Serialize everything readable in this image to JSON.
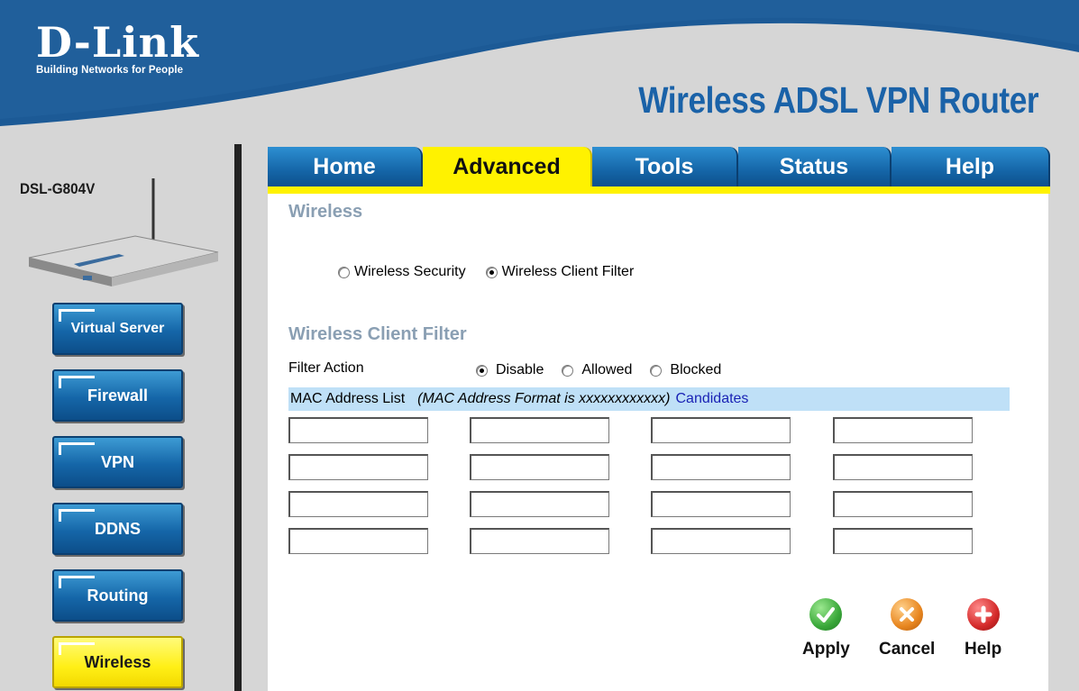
{
  "header": {
    "logo_main": "D-Link",
    "logo_tagline": "Building Networks for People",
    "product_title": "Wireless ADSL VPN Router"
  },
  "sidebar": {
    "model": "DSL-G804V",
    "items": [
      {
        "label": "Virtual Server",
        "active": false
      },
      {
        "label": "Firewall",
        "active": false
      },
      {
        "label": "VPN",
        "active": false
      },
      {
        "label": "DDNS",
        "active": false
      },
      {
        "label": "Routing",
        "active": false
      },
      {
        "label": "Wireless",
        "active": true
      }
    ]
  },
  "tabs": [
    {
      "label": "Home",
      "active": false
    },
    {
      "label": "Advanced",
      "active": true
    },
    {
      "label": "Tools",
      "active": false
    },
    {
      "label": "Status",
      "active": false
    },
    {
      "label": "Help",
      "active": false
    }
  ],
  "main": {
    "section_title": "Wireless",
    "mode_options": [
      {
        "label": "Wireless Security",
        "selected": false
      },
      {
        "label": "Wireless Client Filter",
        "selected": true
      }
    ],
    "filter_title": "Wireless Client Filter",
    "filter_action_label": "Filter Action",
    "filter_actions": [
      {
        "label": "Disable",
        "selected": true
      },
      {
        "label": "Allowed",
        "selected": false
      },
      {
        "label": "Blocked",
        "selected": false
      }
    ],
    "mac_list_label": "MAC Address List",
    "mac_format_hint": "(MAC Address Format is xxxxxxxxxxxx)",
    "candidates_link": "Candidates",
    "mac_fields": [
      "",
      "",
      "",
      "",
      "",
      "",
      "",
      "",
      "",
      "",
      "",
      "",
      "",
      "",
      "",
      ""
    ]
  },
  "actions": {
    "apply": "Apply",
    "cancel": "Cancel",
    "help": "Help"
  },
  "colors": {
    "brand_blue": "#1566a8",
    "active_yellow": "#fff200",
    "section_title": "#8a9fb3",
    "mac_bar": "#bfe0f7",
    "apply_green": "#3aa83a",
    "cancel_orange": "#e8861f",
    "help_red": "#d42a2a"
  }
}
